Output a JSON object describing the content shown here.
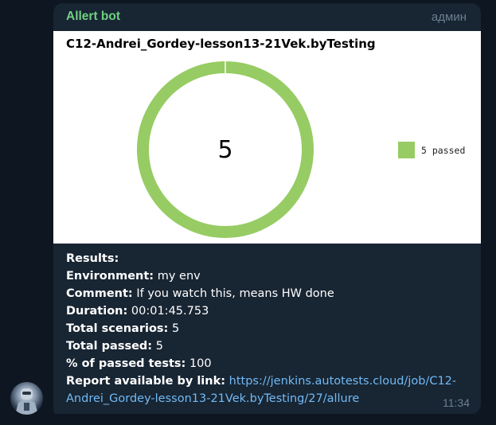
{
  "message": {
    "sender": "Allert bot",
    "role": "админ",
    "time": "11:34"
  },
  "chart_data": {
    "type": "pie",
    "title": "C12-Andrei_Gordey-lesson13-21Vek.byTesting",
    "center_label": "5",
    "slices": [
      {
        "label": "5 passed",
        "value": 5,
        "color": "#97cc64"
      }
    ],
    "legend_position": "right"
  },
  "report": {
    "results_label": "Results:",
    "environment_label": "Environment:",
    "environment_value": "my env",
    "comment_label": "Comment:",
    "comment_value": "If you watch this, means HW done",
    "duration_label": "Duration:",
    "duration_value": "00:01:45.753",
    "total_scenarios_label": "Total scenarios:",
    "total_scenarios_value": "5",
    "total_passed_label": "Total passed:",
    "total_passed_value": "5",
    "percent_label": "% of passed tests:",
    "percent_value": "100",
    "link_label": "Report available by link:",
    "link_url": "https://jenkins.autotests.cloud/job/C12-Andrei_Gordey-lesson13-21Vek.byTesting/27/allure"
  },
  "colors": {
    "background": "#0e1621",
    "bubble": "#182533",
    "sender": "#6fd082",
    "link": "#71baf5",
    "muted": "#6d7f8f"
  }
}
